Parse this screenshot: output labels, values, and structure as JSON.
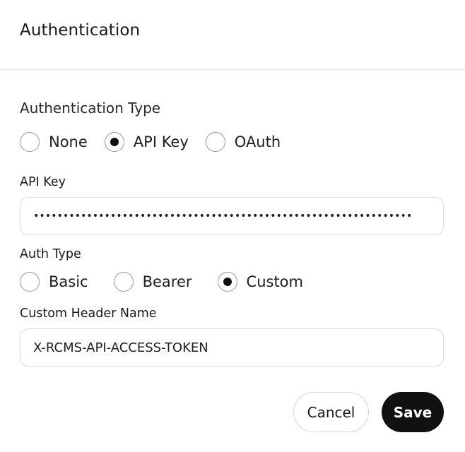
{
  "dialog": {
    "title": "Authentication"
  },
  "auth_type": {
    "label": "Authentication Type",
    "options": [
      {
        "label": "None",
        "checked": false
      },
      {
        "label": "API Key",
        "checked": true
      },
      {
        "label": "OAuth",
        "checked": false
      }
    ],
    "selected": "API Key"
  },
  "api_key": {
    "label": "API Key",
    "value": "••••••••••••••••••••••••••••••••••••••••••••••••••••••••••••••••",
    "masked": true
  },
  "header_auth_type": {
    "label": "Auth Type",
    "options": [
      {
        "label": "Basic",
        "checked": false
      },
      {
        "label": "Bearer",
        "checked": false
      },
      {
        "label": "Custom",
        "checked": true
      }
    ],
    "selected": "Custom"
  },
  "custom_header": {
    "label": "Custom Header Name",
    "value": "X-RCMS-API-ACCESS-TOKEN"
  },
  "footer": {
    "cancel_label": "Cancel",
    "save_label": "Save"
  },
  "colors": {
    "primary_button_bg": "#111111",
    "primary_button_text": "#ffffff",
    "border": "#dcdcdc"
  }
}
